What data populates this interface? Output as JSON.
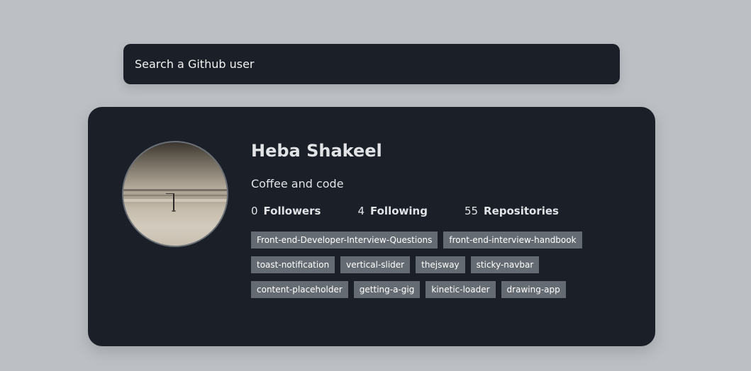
{
  "search": {
    "placeholder": "Search a Github user"
  },
  "profile": {
    "name": "Heba Shakeel",
    "bio": "Coffee and code",
    "avatar_icon": "profile-photo-landscape",
    "stats": {
      "followers": {
        "count": "0",
        "label": "Followers"
      },
      "following": {
        "count": "4",
        "label": "Following"
      },
      "repositories": {
        "count": "55",
        "label": "Repositories"
      }
    }
  },
  "repos": [
    "Front-end-Developer-Interview-Questions",
    "front-end-interview-handbook",
    "toast-notification",
    "vertical-slider",
    "thejsway",
    "sticky-navbar",
    "content-placeholder",
    "getting-a-gig",
    "kinetic-loader",
    "drawing-app"
  ],
  "colors": {
    "page_background": "#bcc0c5",
    "card_background": "#1a1f28",
    "repo_tag_background": "#646b72",
    "text": "#e1e3e6"
  }
}
